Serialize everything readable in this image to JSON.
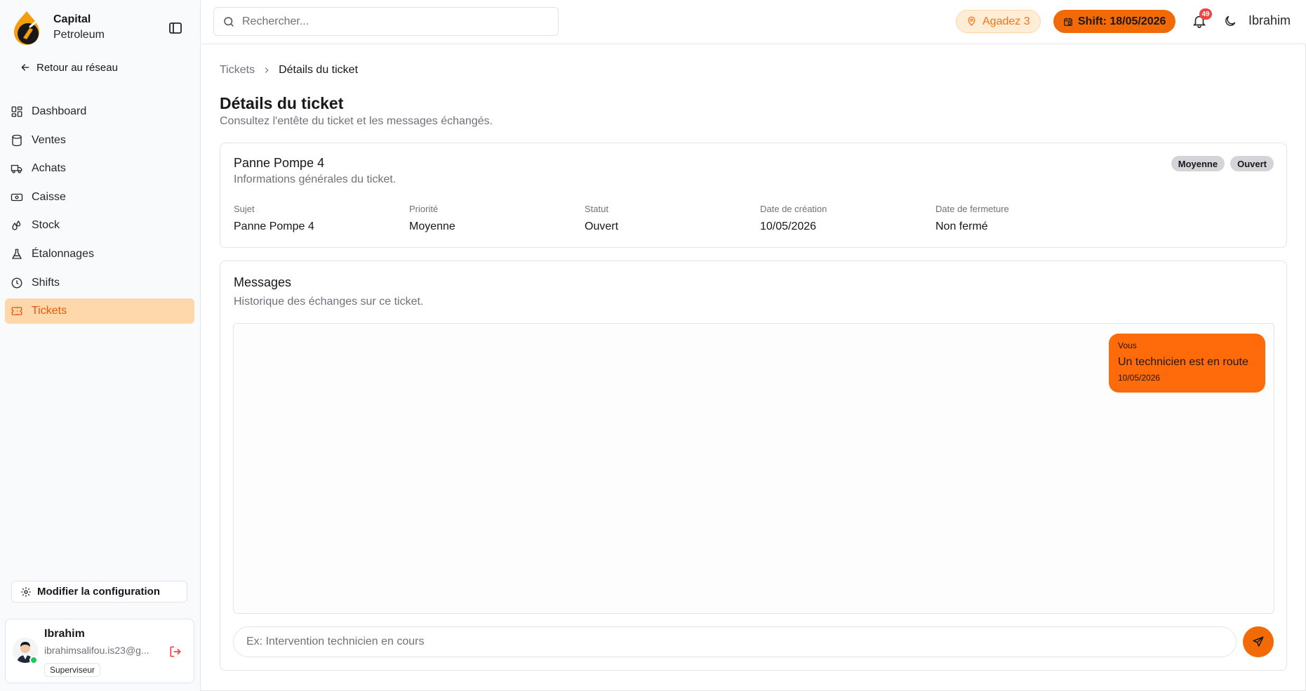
{
  "brand": {
    "name": "Capital",
    "sub": "Petroleum"
  },
  "sidebar": {
    "back_label": "Retour au réseau",
    "items": [
      {
        "label": "Dashboard",
        "icon": "dashboard-icon"
      },
      {
        "label": "Ventes",
        "icon": "database-icon"
      },
      {
        "label": "Achats",
        "icon": "truck-icon"
      },
      {
        "label": "Caisse",
        "icon": "banknote-icon"
      },
      {
        "label": "Stock",
        "icon": "droplets-icon"
      },
      {
        "label": "Étalonnages",
        "icon": "flask-icon"
      },
      {
        "label": "Shifts",
        "icon": "clock-icon"
      },
      {
        "label": "Tickets",
        "icon": "ticket-icon",
        "active": true
      }
    ],
    "config_label": "Modifier la configuration",
    "user": {
      "name": "Ibrahim",
      "email": "ibrahimsalifou.is23@g...",
      "role": "Superviseur"
    }
  },
  "topbar": {
    "search_placeholder": "Rechercher...",
    "station": "Agadez 3",
    "shift": "Shift: 18/05/2026",
    "notifications": "49",
    "user": "Ibrahim"
  },
  "breadcrumb": {
    "parent": "Tickets",
    "current": "Détails du ticket"
  },
  "page": {
    "title": "Détails du ticket",
    "subtitle": "Consultez l'entête du ticket et les messages échangés."
  },
  "ticket": {
    "title": "Panne Pompe 4",
    "subtitle": "Informations générales du ticket.",
    "badges": [
      "Moyenne",
      "Ouvert"
    ],
    "fields": [
      {
        "label": "Sujet",
        "value": "Panne Pompe 4"
      },
      {
        "label": "Priorité",
        "value": "Moyenne"
      },
      {
        "label": "Statut",
        "value": "Ouvert"
      },
      {
        "label": "Date de création",
        "value": "10/05/2026"
      },
      {
        "label": "Date de fermeture",
        "value": "Non fermé"
      }
    ]
  },
  "messages": {
    "title": "Messages",
    "subtitle": "Historique des échanges sur ce ticket.",
    "items": [
      {
        "author": "Vous",
        "text": "Un technicien est en route",
        "date": "10/05/2026"
      }
    ],
    "input_placeholder": "Ex: Intervention technicien en cours"
  },
  "colors": {
    "accent": "#f26a05",
    "active_bg": "#fed7aa",
    "active_text": "#ea580c"
  }
}
